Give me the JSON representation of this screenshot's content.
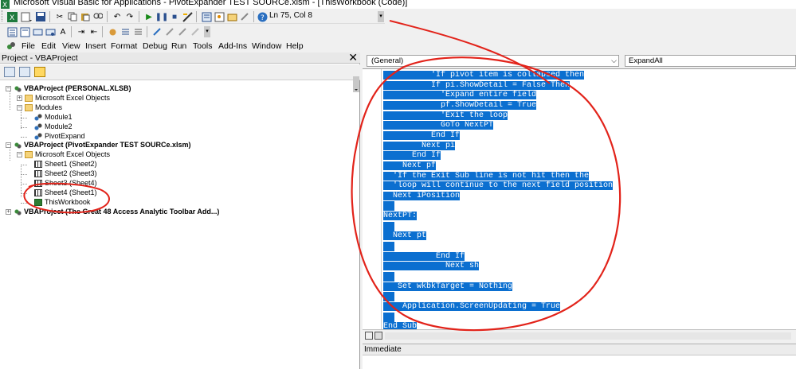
{
  "window": {
    "title": "Microsoft Visual Basic for Applications - PivotExpander TEST SOURCe.xlsm - [ThisWorkbook (Code)]"
  },
  "toolbar": {
    "position": "Ln 75, Col 8"
  },
  "menu": [
    "File",
    "Edit",
    "View",
    "Insert",
    "Format",
    "Debug",
    "Run",
    "Tools",
    "Add-Ins",
    "Window",
    "Help"
  ],
  "project": {
    "title": "Project - VBAProject",
    "close": "✕",
    "tree": [
      {
        "label": "VBAProject (PERSONAL.XLSB)",
        "level": 0,
        "bold": true,
        "icon": "vba-project-icon",
        "expander": "−"
      },
      {
        "label": "Microsoft Excel Objects",
        "level": 1,
        "icon": "folder-icon",
        "expander": "+"
      },
      {
        "label": "Modules",
        "level": 1,
        "icon": "folder-icon",
        "expander": "−"
      },
      {
        "label": "Module1",
        "level": 2,
        "icon": "module-icon"
      },
      {
        "label": "Module2",
        "level": 2,
        "icon": "module-icon"
      },
      {
        "label": "PivotExpand",
        "level": 2,
        "icon": "module-icon"
      },
      {
        "label": "VBAProject (PivotExpander TEST SOURCe.xlsm)",
        "level": 0,
        "bold": true,
        "icon": "vba-project-icon",
        "expander": "−"
      },
      {
        "label": "Microsoft Excel Objects",
        "level": 1,
        "icon": "folder-icon",
        "expander": "−"
      },
      {
        "label": "Sheet1 (Sheet2)",
        "level": 2,
        "icon": "sheet-icon"
      },
      {
        "label": "Sheet2 (Sheet3)",
        "level": 2,
        "icon": "sheet-icon"
      },
      {
        "label": "Sheet3 (Sheet4)",
        "level": 2,
        "icon": "sheet-icon"
      },
      {
        "label": "Sheet4 (Sheet1)",
        "level": 2,
        "icon": "sheet-icon"
      },
      {
        "label": "ThisWorkbook",
        "level": 2,
        "icon": "workbook-icon"
      },
      {
        "label": "VBAProject (The Great 48 Access Analytic Toolbar Add...)",
        "level": 0,
        "bold": true,
        "icon": "vba-project-icon",
        "expander": "+"
      }
    ]
  },
  "code": {
    "object_combo": "(General)",
    "proc_combo": "ExpandAll",
    "lines": [
      "          'If pivot item is collapsed then",
      "          If pi.ShowDetail = False Then",
      "            'Expand entire field",
      "            pf.ShowDetail = True",
      "            'Exit the loop",
      "            GoTo NextPT",
      "          End If",
      "        Next pi",
      "      End If",
      "    Next pf",
      "  'If the Exit Sub line is not hit then the",
      "  'loop will continue to the next field position",
      "  Next iPosition",
      "",
      "NextPT:",
      "",
      "  Next pt",
      "",
      "           End If",
      "             Next sh",
      "",
      "   Set wkbkTarget = Nothing",
      "",
      "    Application.ScreenUpdating = True",
      "",
      "End Sub"
    ]
  },
  "immediate": {
    "title": "Immediate"
  },
  "annotation_color": "#e2231a"
}
